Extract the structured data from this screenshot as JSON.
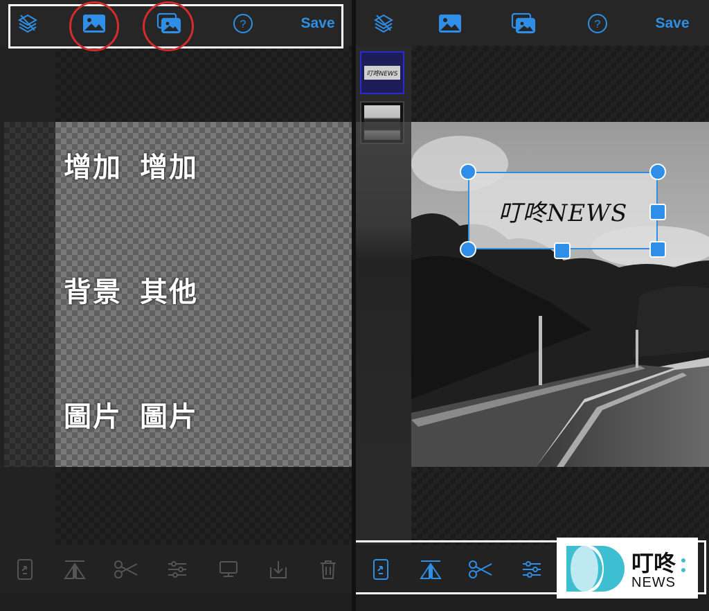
{
  "left": {
    "toolbar": {
      "save_label": "Save"
    },
    "caption": {
      "col1": [
        "增加",
        "背景",
        "圖片"
      ],
      "col2": [
        "增加",
        "其他",
        "圖片"
      ]
    }
  },
  "right": {
    "toolbar": {
      "save_label": "Save"
    },
    "layers": [
      {
        "name": "text-sticker",
        "label": "叮咚NEWS",
        "selected": true
      },
      {
        "name": "photo",
        "label": "",
        "selected": false
      }
    ],
    "sticker_text": "叮咚NEWS"
  },
  "watermark": {
    "cn": "叮咚",
    "en": "NEWS"
  },
  "colors": {
    "accent": "#2f8fe8",
    "annotation_red": "#d42c2c",
    "annotation_white": "#ffffff",
    "logo_teal": "#3dbfd1"
  }
}
